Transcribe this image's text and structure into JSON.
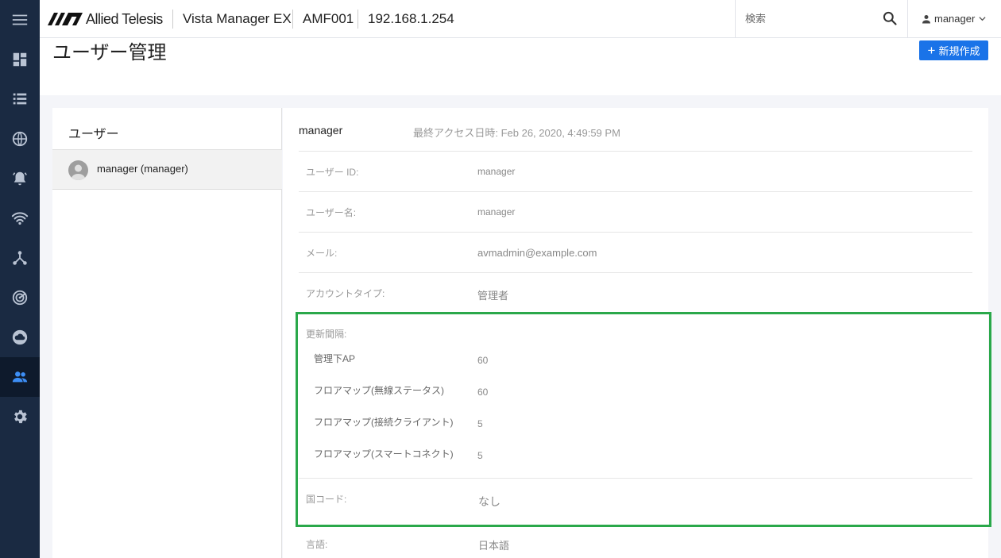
{
  "header": {
    "brand": "Allied Telesis",
    "product": "Vista Manager EX",
    "device": "AMF001",
    "ip": "192.168.1.254",
    "search_placeholder": "検索",
    "user": "manager"
  },
  "page": {
    "title": "ユーザー管理",
    "new_button": "新規作成"
  },
  "user_list": {
    "title": "ユーザー",
    "items": [
      {
        "label": "manager (manager)"
      }
    ]
  },
  "detail": {
    "name": "manager",
    "last_access": "最終アクセス日時: Feb 26, 2020, 4:49:59 PM",
    "fields": {
      "user_id": {
        "label": "ユーザー ID:",
        "value": "manager"
      },
      "user_name": {
        "label": "ユーザー名:",
        "value": "manager"
      },
      "email": {
        "label": "メール:",
        "value": "avmadmin@example.com"
      },
      "account_type": {
        "label": "アカウントタイプ:",
        "value": "管理者"
      },
      "refresh_interval": {
        "label": "更新間隔:"
      },
      "managed_ap": {
        "label": "管理下AP",
        "value": "60"
      },
      "floormap_wireless": {
        "label": "フロアマップ(無線ステータス)",
        "value": "60"
      },
      "floormap_clients": {
        "label": "フロアマップ(接続クライアント)",
        "value": "5"
      },
      "floormap_smart": {
        "label": "フロアマップ(スマートコネクト)",
        "value": "5"
      },
      "country_code": {
        "label": "国コード:",
        "value": "なし"
      },
      "language": {
        "label": "言語:",
        "value": "日本語"
      }
    }
  },
  "colors": {
    "rail": "#1a2a42",
    "rail_icon": "#b9c3d3",
    "rail_active_icon": "#3d8ef5",
    "primary": "#1a73e8",
    "highlight": "#2aa84a"
  },
  "rail_icons": [
    "menu-icon",
    "dashboard-icon",
    "list-icon",
    "globe-icon",
    "alarm-icon",
    "wifi-icon",
    "topology-icon",
    "radar-icon",
    "cloud-icon",
    "users-icon",
    "gear-icon"
  ]
}
